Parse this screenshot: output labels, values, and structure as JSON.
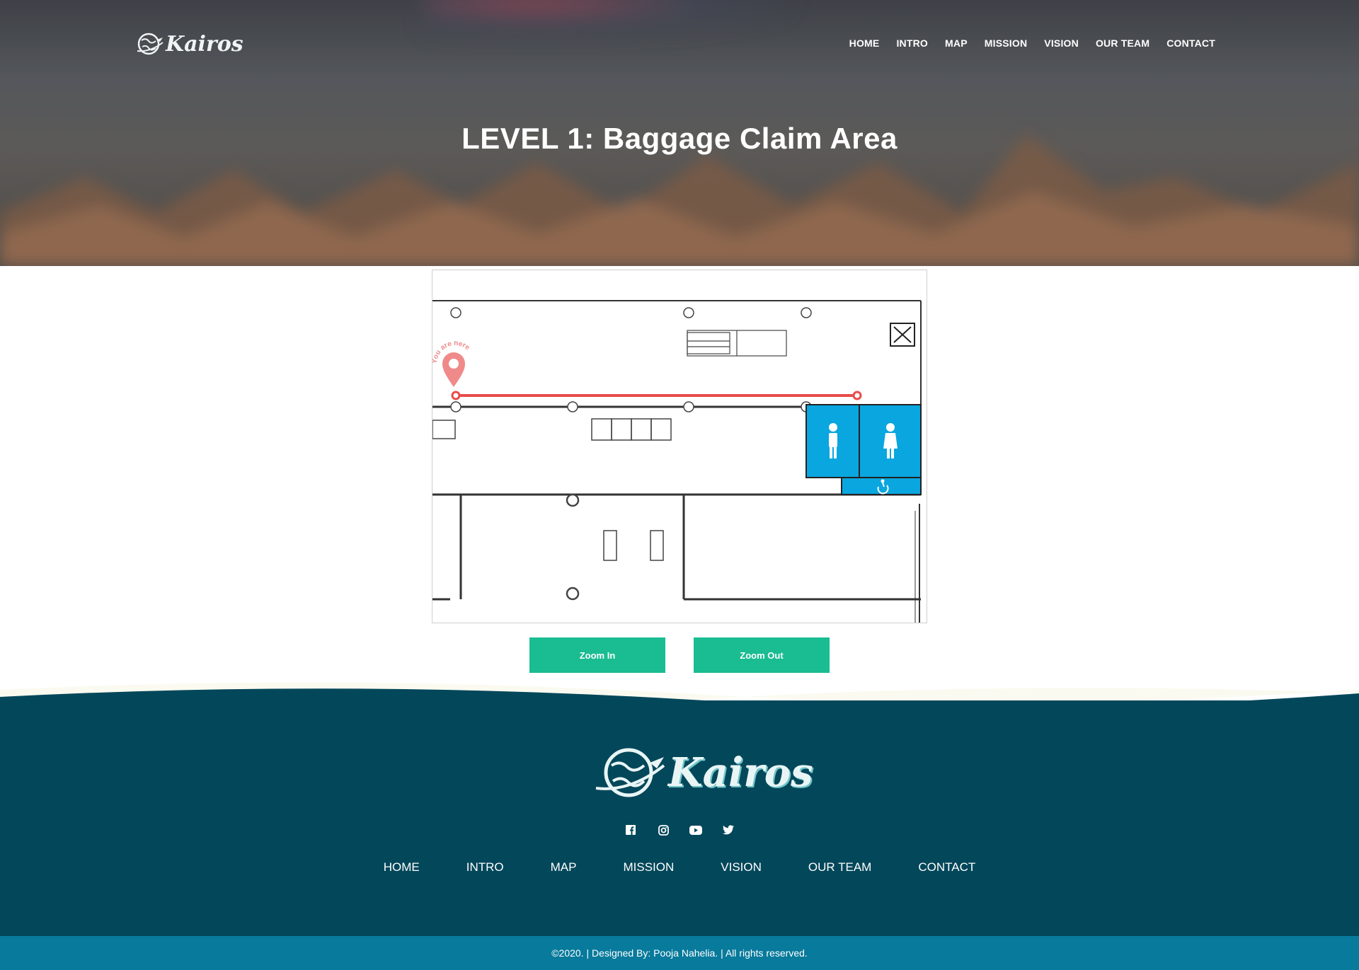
{
  "header": {
    "logo_text": "Kairos",
    "nav": [
      "HOME",
      "INTRO",
      "MAP",
      "MISSION",
      "VISION",
      "OUR TEAM",
      "CONTACT"
    ]
  },
  "hero": {
    "title": "LEVEL 1: Baggage Claim Area"
  },
  "map": {
    "you_are_here": "You are here",
    "colors": {
      "restroom": "#0aa6df",
      "route": "#e84b4b",
      "marker": "#f08a8a"
    }
  },
  "controls": {
    "zoom_in": "Zoom In",
    "zoom_out": "Zoom Out"
  },
  "footer": {
    "logo_text": "Kairos",
    "social": [
      "facebook-icon",
      "instagram-icon",
      "youtube-icon",
      "twitter-icon"
    ],
    "nav": [
      "HOME",
      "INTRO",
      "MAP",
      "MISSION",
      "VISION",
      "OUR TEAM",
      "CONTACT"
    ],
    "copyright": "©2020. | Designed By: Pooja Nahelia. | All rights reserved."
  },
  "colors": {
    "accent": "#1abc92",
    "footer_bg": "#03475a",
    "bottom_bar": "#087a9c"
  }
}
